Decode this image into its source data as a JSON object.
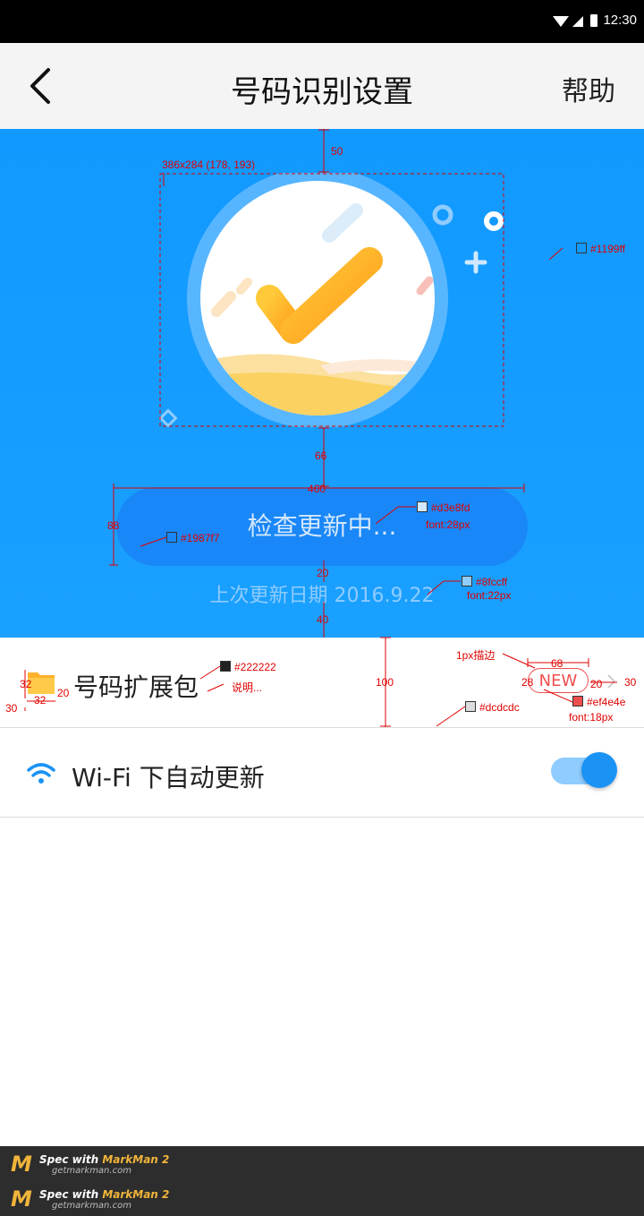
{
  "status_bar": {
    "time": "12:30"
  },
  "header": {
    "title": "号码识别设置",
    "help_label": "帮助"
  },
  "hero": {
    "check_button_label": "检查更新中...",
    "last_update": "上次更新日期 2016.9.22"
  },
  "list": {
    "items": [
      {
        "label": "号码扩展包",
        "badge": "NEW"
      },
      {
        "label": "Wi-Fi 下自动更新",
        "toggle_on": true
      }
    ]
  },
  "annotations": {
    "top_gap": "50",
    "illus_box": "386x284 (178, 193)",
    "hero_bg": "#1199ff",
    "illus_gap": "66",
    "btn_width": "460",
    "btn_height": "88",
    "btn_color": "#1987f7",
    "btn_text_color": "#d3e8fd",
    "btn_font": "font:28px",
    "gap_20": "20",
    "date_color": "#8fccff",
    "date_font": "font:22px",
    "gap_40": "40",
    "label_color": "#222222",
    "label_note": "说明...",
    "icon_32a": "32",
    "icon_32b": "32",
    "icon_gap": "20",
    "left_margin": "30",
    "row_height": "100",
    "divider_color": "#dcdcdc",
    "stroke_note": "1px描边",
    "badge_width": "68",
    "badge_height": "28",
    "badge_gap": "20",
    "right_margin": "30",
    "badge_color": "#ef4e4e",
    "badge_font": "font:18px"
  },
  "footer": {
    "line1_prefix": "Spec with ",
    "line1_brand": "MarkMan 2",
    "line2": "getmarkman.com"
  },
  "colors": {
    "hero_bg": "#1199ff",
    "button_bg": "#1987f7",
    "button_text": "#d3e8fd",
    "date_text": "#8fccff",
    "label_text": "#222222",
    "divider": "#dcdcdc",
    "badge": "#ef4e4e"
  }
}
